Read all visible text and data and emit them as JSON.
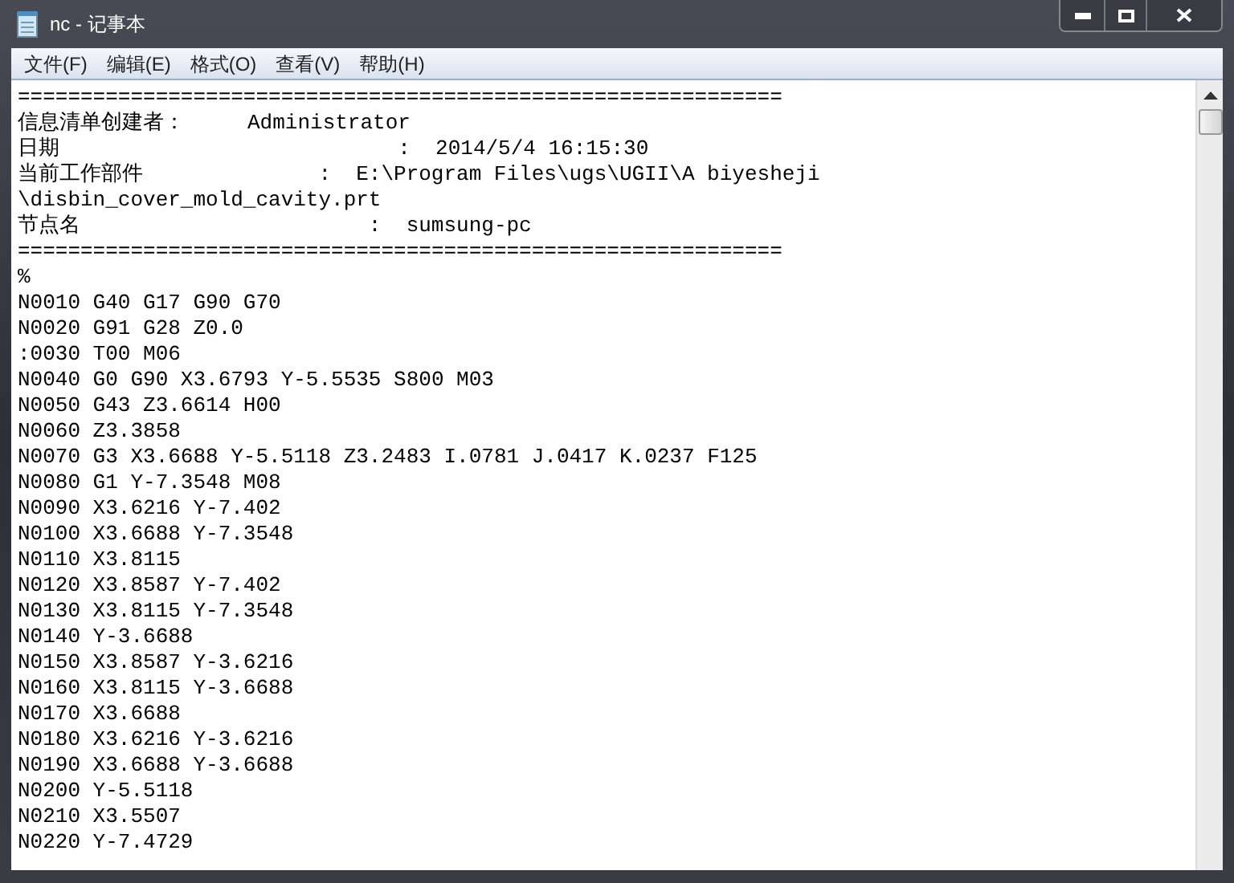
{
  "window": {
    "title": "nc - 记事本"
  },
  "menu": [
    "文件(F)",
    "编辑(E)",
    "格式(O)",
    "查看(V)",
    "帮助(H)"
  ],
  "lines": [
    "=============================================================",
    "信息清单创建者：     Administrator",
    "日期                           :  2014/5/4 16:15:30",
    "当前工作部件              :  E:\\Program Files\\ugs\\UGII\\A biyesheji",
    "\\disbin_cover_mold_cavity.prt",
    "节点名                       :  sumsung-pc",
    "=============================================================",
    "%",
    "N0010 G40 G17 G90 G70",
    "N0020 G91 G28 Z0.0",
    ":0030 T00 M06",
    "N0040 G0 G90 X3.6793 Y-5.5535 S800 M03",
    "N0050 G43 Z3.6614 H00",
    "N0060 Z3.3858",
    "N0070 G3 X3.6688 Y-5.5118 Z3.2483 I.0781 J.0417 K.0237 F125",
    "N0080 G1 Y-7.3548 M08",
    "N0090 X3.6216 Y-7.402",
    "N0100 X3.6688 Y-7.3548",
    "N0110 X3.8115",
    "N0120 X3.8587 Y-7.402",
    "N0130 X3.8115 Y-7.3548",
    "N0140 Y-3.6688",
    "N0150 X3.8587 Y-3.6216",
    "N0160 X3.8115 Y-3.6688",
    "N0170 X3.6688",
    "N0180 X3.6216 Y-3.6216",
    "N0190 X3.6688 Y-3.6688",
    "N0200 Y-5.5118",
    "N0210 X3.5507",
    "N0220 Y-7.4729"
  ]
}
